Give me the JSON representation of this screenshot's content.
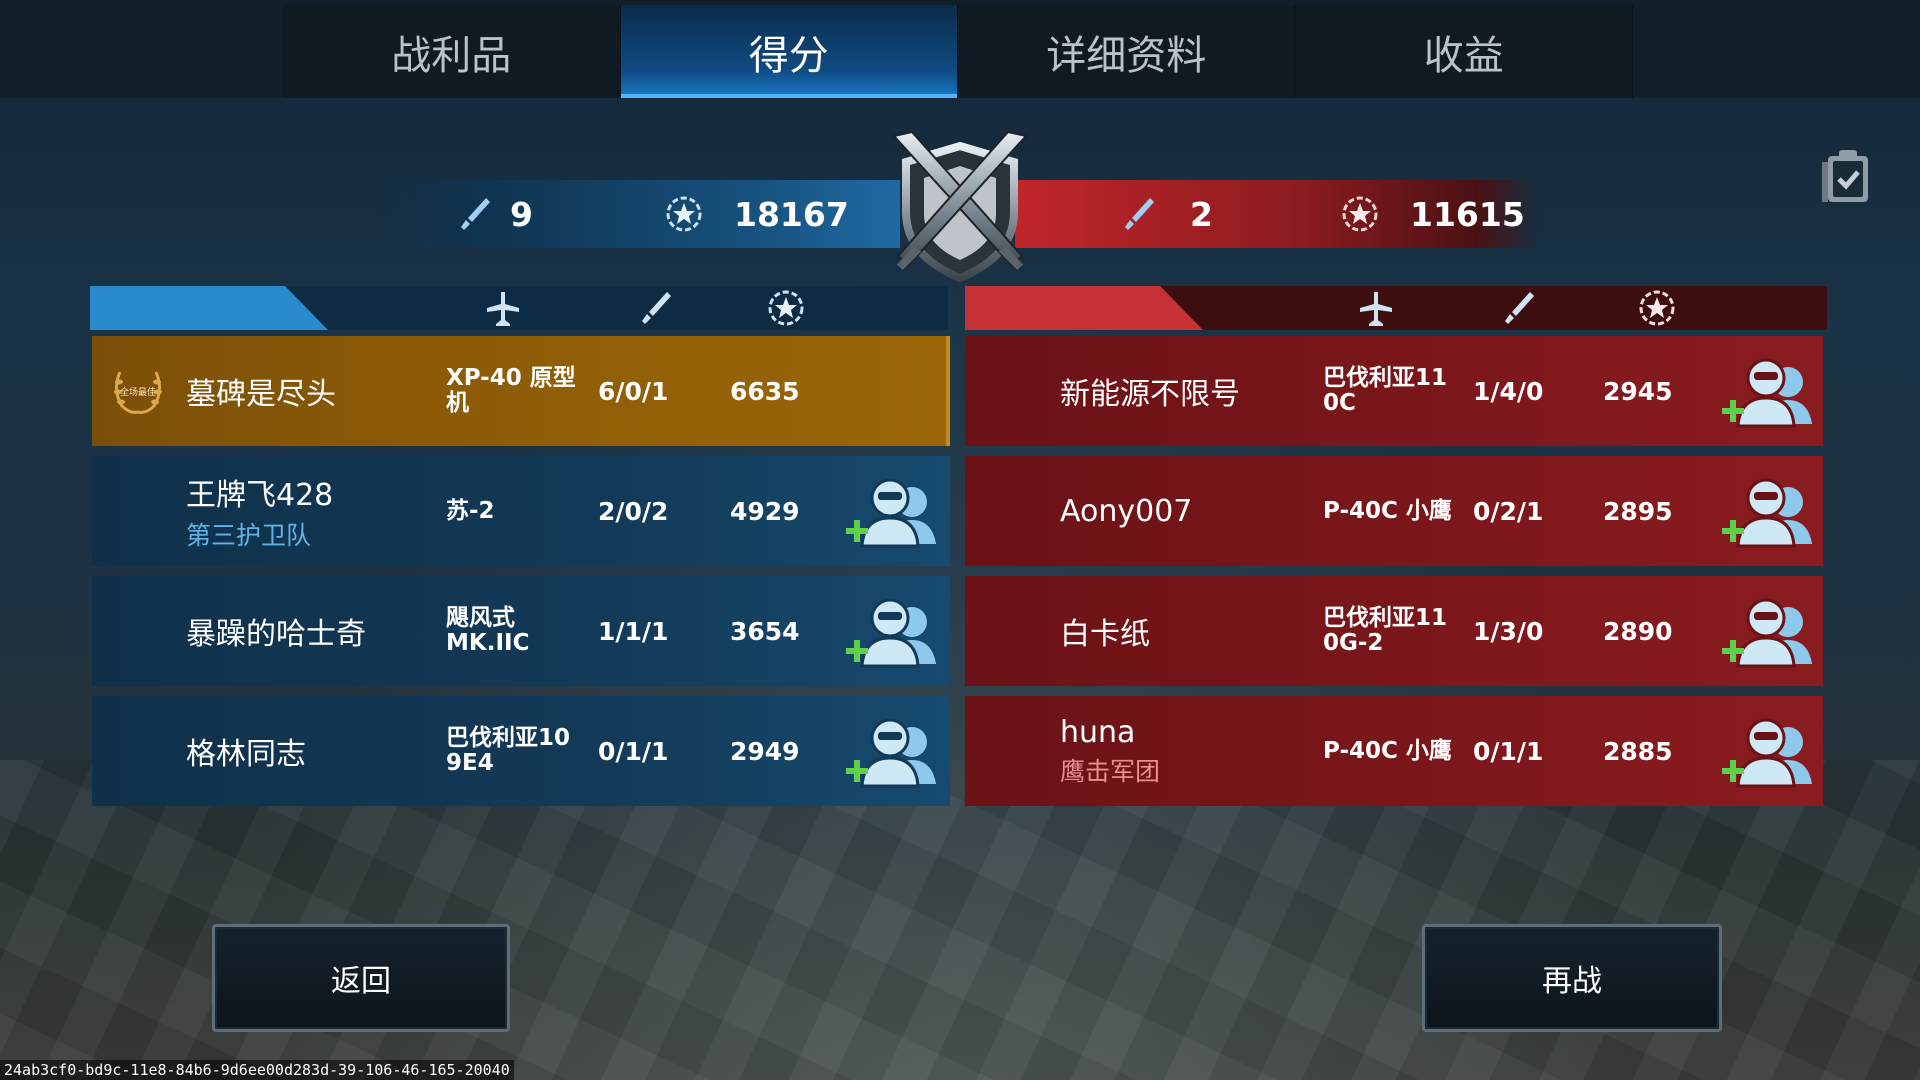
{
  "tabs": [
    {
      "label": "战利品",
      "active": false
    },
    {
      "label": "得分",
      "active": true
    },
    {
      "label": "详细资料",
      "active": false
    },
    {
      "label": "收益",
      "active": false
    }
  ],
  "summary": {
    "blue": {
      "kills": "9",
      "score": "18167"
    },
    "red": {
      "kills": "2",
      "score": "11615"
    }
  },
  "blue_team": [
    {
      "name": "墓碑是尽头",
      "clan": "",
      "plane": "XP-40 原型机",
      "kda": "6/0/1",
      "score": "6635",
      "mvp": true,
      "mvp_text": "全场最佳"
    },
    {
      "name": "王牌飞428",
      "clan": "第三护卫队",
      "plane": "苏-2",
      "kda": "2/0/2",
      "score": "4929",
      "mvp": false
    },
    {
      "name": "暴躁的哈士奇",
      "clan": "",
      "plane": "飓风式 MK.IIC",
      "kda": "1/1/1",
      "score": "3654",
      "mvp": false
    },
    {
      "name": "格林同志",
      "clan": "",
      "plane": "巴伐利亚10 9E4",
      "kda": "0/1/1",
      "score": "2949",
      "mvp": false
    }
  ],
  "red_team": [
    {
      "name": "新能源不限号",
      "clan": "",
      "plane": "巴伐利亚11 0C",
      "kda": "1/4/0",
      "score": "2945"
    },
    {
      "name": "Aony007",
      "clan": "",
      "plane": "P-40C 小鹰",
      "kda": "0/2/1",
      "score": "2895"
    },
    {
      "name": "白卡纸",
      "clan": "",
      "plane": "巴伐利亚11 0G-2",
      "kda": "1/3/0",
      "score": "2890"
    },
    {
      "name": "huna",
      "clan": "鹰击军团",
      "plane": "P-40C 小鹰",
      "kda": "0/1/1",
      "score": "2885"
    }
  ],
  "buttons": {
    "back": "返回",
    "replay": "再战"
  },
  "footer_id": "24ab3cf0-bd9c-11e8-84b6-9d6ee00d283d-39-106-46-165-20040",
  "colors": {
    "blue_team": "#1f6aa2",
    "red_team": "#c0262a",
    "mvp_row": "#8e5c07",
    "active_tab": "#1a79c8"
  },
  "icons": [
    "plane-icon",
    "sword-icon",
    "star-medal-icon",
    "add-friend-icon",
    "clipboard-check-icon",
    "crossed-swords-shield-emblem",
    "mvp-laurel-icon"
  ]
}
